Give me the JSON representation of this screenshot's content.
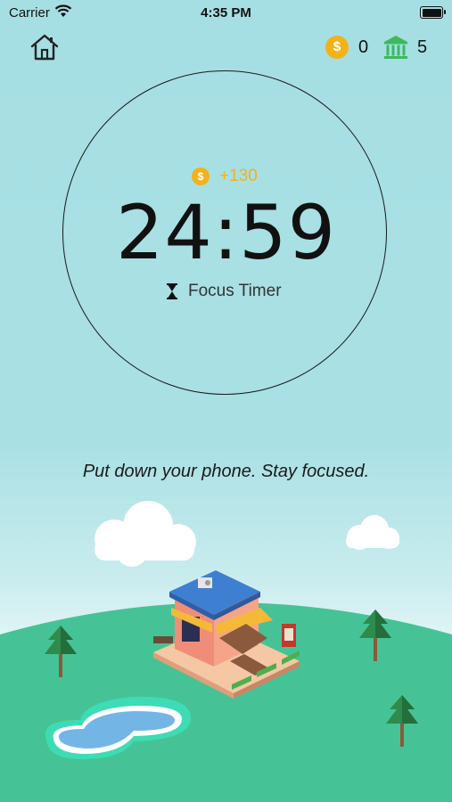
{
  "status_bar": {
    "carrier": "Carrier",
    "time": "4:35 PM"
  },
  "header": {
    "home_icon": "home-icon",
    "coin_symbol": "$",
    "coins": "0",
    "bank_icon": "bank-icon",
    "buildings": "5"
  },
  "timer": {
    "reward": "+130",
    "time": "24:59",
    "mode_icon": "hourglass-icon",
    "label": "Focus Timer"
  },
  "motto": "Put down your phone. Stay focused.",
  "colors": {
    "sky": "#a6dfe3",
    "grass": "#46c396",
    "coin": "#f2b21a",
    "bank": "#3cb95d"
  }
}
